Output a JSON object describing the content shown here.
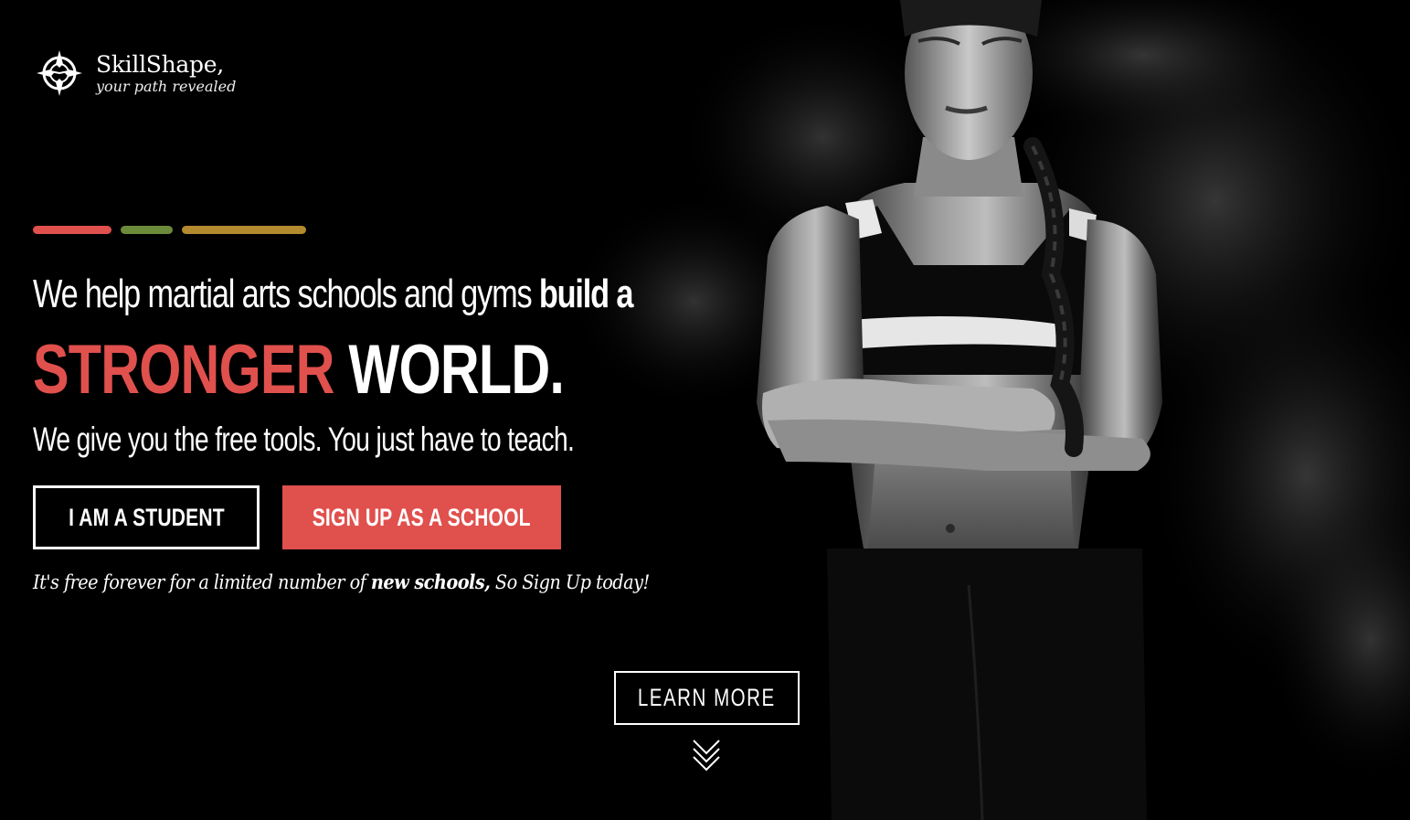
{
  "brand": {
    "name": "SkillShape,",
    "tagline": "your path revealed",
    "logo_icon": "compass-icon"
  },
  "accent_colors": [
    "#e0504d",
    "#6b8a3a",
    "#b38a2e"
  ],
  "hero": {
    "line1_regular": "We help martial arts schools and gyms ",
    "line1_bold": "build a",
    "line2_red": "STRONGER",
    "line2_white": " WORLD.",
    "line3": "We give you the free tools. You just have to teach."
  },
  "buttons": {
    "student": "I AM A STUDENT",
    "school": "SIGN UP AS A SCHOOL",
    "learn_more": "LEARN MORE"
  },
  "promo": {
    "before": "It's free forever for a limited number of ",
    "bold": "new schools,",
    "after": " So Sign Up today!"
  },
  "colors": {
    "accent_red": "#e0504d",
    "background": "#000000"
  },
  "icons": {
    "scroll": "double-chevron-down-icon"
  }
}
